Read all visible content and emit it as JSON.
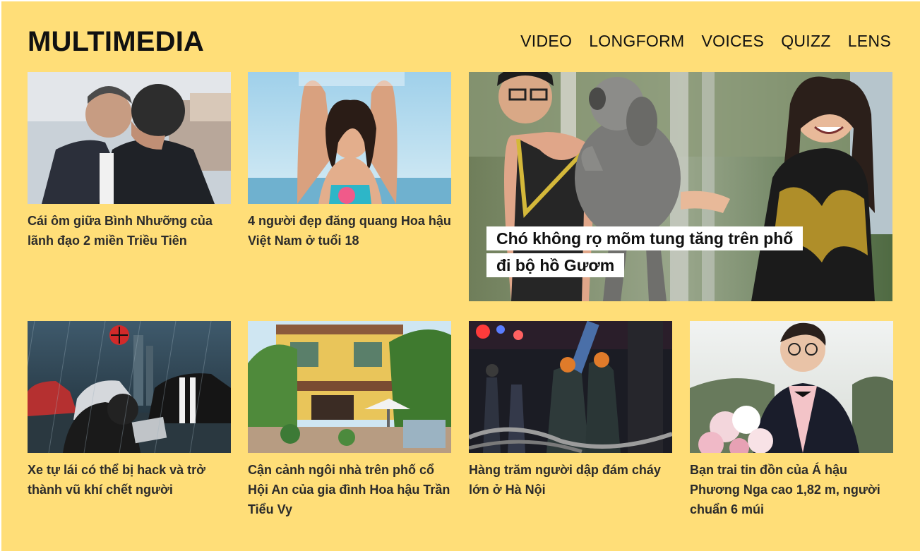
{
  "header": {
    "title": "MULTIMEDIA",
    "nav": [
      "VIDEO",
      "LONGFORM",
      "VOICES",
      "QUIZZ",
      "LENS"
    ]
  },
  "feature": {
    "caption": "Chó không rọ mõm tung tăng trên phố đi bộ hồ Gươm"
  },
  "cards": [
    {
      "caption": "Cái ôm giữa Bình Nhưỡng của lãnh đạo 2 miền Triều Tiên"
    },
    {
      "caption": "4 người đẹp đăng quang Hoa hậu Việt Nam ở tuổi 18"
    },
    {
      "caption": "Xe tự lái có thể bị hack và trở thành vũ khí chết người"
    },
    {
      "caption": "Cận cảnh ngôi nhà trên phố cổ Hội An của gia đình Hoa hậu Trần Tiểu Vy"
    },
    {
      "caption": "Hàng trăm người dập đám cháy lớn ở Hà Nội"
    },
    {
      "caption": "Bạn trai tin đồn của Á hậu Phương Nga cao 1,82 m, người chuẩn 6 múi"
    }
  ],
  "colors": {
    "background": "#ffde78",
    "caption_box": "#ffffff"
  }
}
